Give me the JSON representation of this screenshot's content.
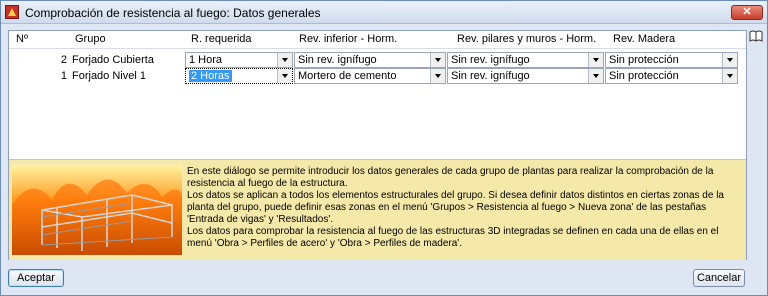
{
  "window": {
    "title": "Comprobación de resistencia al fuego: Datos generales",
    "close_label": "✕"
  },
  "table": {
    "headers": [
      "Nº",
      "Grupo",
      "R. requerida",
      "Rev. inferior - Horm.",
      "Rev. pilares y muros - Horm.",
      "Rev. Madera"
    ],
    "rows": [
      {
        "num": "2",
        "grupo": "Forjado Cubierta",
        "r_requerida": "1 Hora",
        "rev_inferior": "Sin rev. ignífugo",
        "rev_pilares": "Sin rev. ignífugo",
        "rev_madera": "Sin protección"
      },
      {
        "num": "1",
        "grupo": "Forjado Nivel 1",
        "r_requerida": "2 Horas",
        "rev_inferior": "Mortero de cemento",
        "rev_pilares": "Sin rev. ignífugo",
        "rev_madera": "Sin protección"
      }
    ]
  },
  "info": {
    "lines": [
      "En este diálogo se permite introducir los datos generales de cada grupo de plantas para realizar la comprobación de la resistencia al fuego de la estructura.",
      "Los datos se aplican a todos los elementos estructurales del grupo. Si desea definir datos distintos en ciertas zonas de la planta del grupo, puede definir esas zonas en el menú 'Grupos > Resistencia al fuego > Nueva zona' de las pestañas 'Entrada de vigas' y 'Resultados'.",
      "Los datos para comprobar la resistencia al fuego de las estructuras 3D integradas se definen en cada una de ellas en el menú 'Obra > Perfiles de acero' y 'Obra > Perfiles de madera'."
    ]
  },
  "buttons": {
    "accept": "Aceptar",
    "cancel": "Cancelar"
  },
  "icons": {
    "app": "fire-app-icon",
    "help": "book-help-icon",
    "dropdown": "chevron-down-icon"
  },
  "colors": {
    "titlebar": "#cfdcee",
    "selection": "#3399ff",
    "info_bg": "#f5e9a9",
    "close": "#c7402d"
  }
}
